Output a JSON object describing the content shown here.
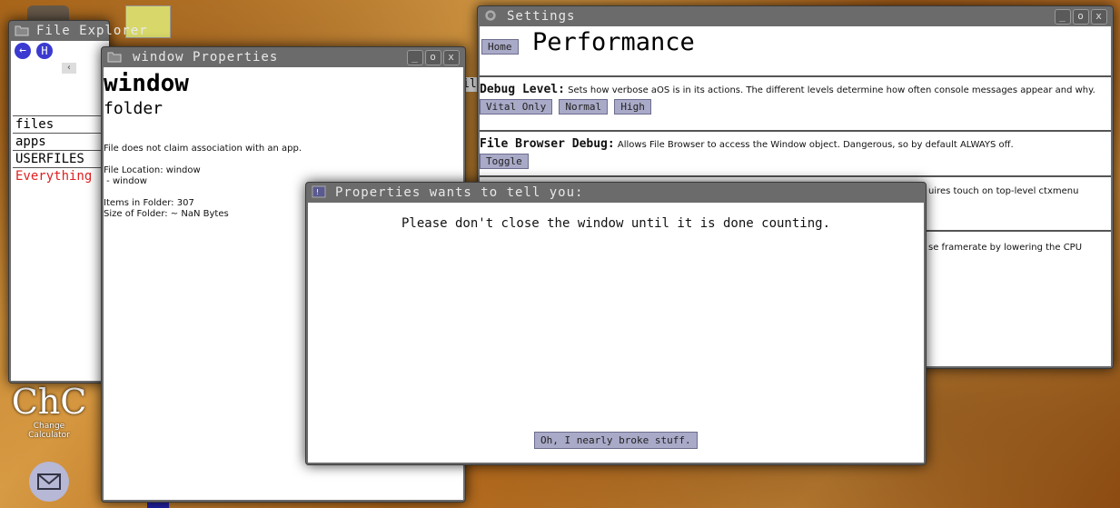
{
  "desktop": {
    "app_label_abbrev": "ChC",
    "app_label_line1": "Change",
    "app_label_line2": "Calculator"
  },
  "file_explorer": {
    "title": "File Explorer",
    "back_glyph": "←",
    "home_glyph": "H",
    "scroll_glyph": "‹",
    "items": [
      "files",
      "apps",
      "USERFILES",
      "Everything"
    ],
    "overflow_text": "il"
  },
  "properties_window": {
    "title": "window Properties",
    "name": "window",
    "type": "folder",
    "association": "File does not claim association with an app.",
    "location_label": "File Location: window",
    "location_path": " - window",
    "items_count": "Items in Folder: 307",
    "size": "Size of Folder: ~ NaN Bytes"
  },
  "settings": {
    "title": "Settings",
    "home_button": "Home",
    "heading": "Performance",
    "debug_level": {
      "label": "Debug Level:",
      "desc": "Sets how verbose aOS is in its actions. The different levels determine how often console messages appear and why.",
      "options": [
        "Vital Only",
        "Normal",
        "High"
      ]
    },
    "file_browser_debug": {
      "label": "File Browser Debug:",
      "desc": "Allows File Browser to access the Window object. Dangerous, so by default ALWAYS off.",
      "toggle": "Toggle"
    },
    "partial_text_1": "uires touch on top-level ctxmenu",
    "partial_text_2": "se framerate by lowering the CPU"
  },
  "dialog": {
    "title": "Properties wants to tell you:",
    "message": "Please don't close the window until it is done counting.",
    "button": "Oh, I nearly broke stuff."
  },
  "colors": {
    "button_bg": "#a9a9c8",
    "highlight_red": "#e02020",
    "nav_blue": "#3a3ad0"
  }
}
